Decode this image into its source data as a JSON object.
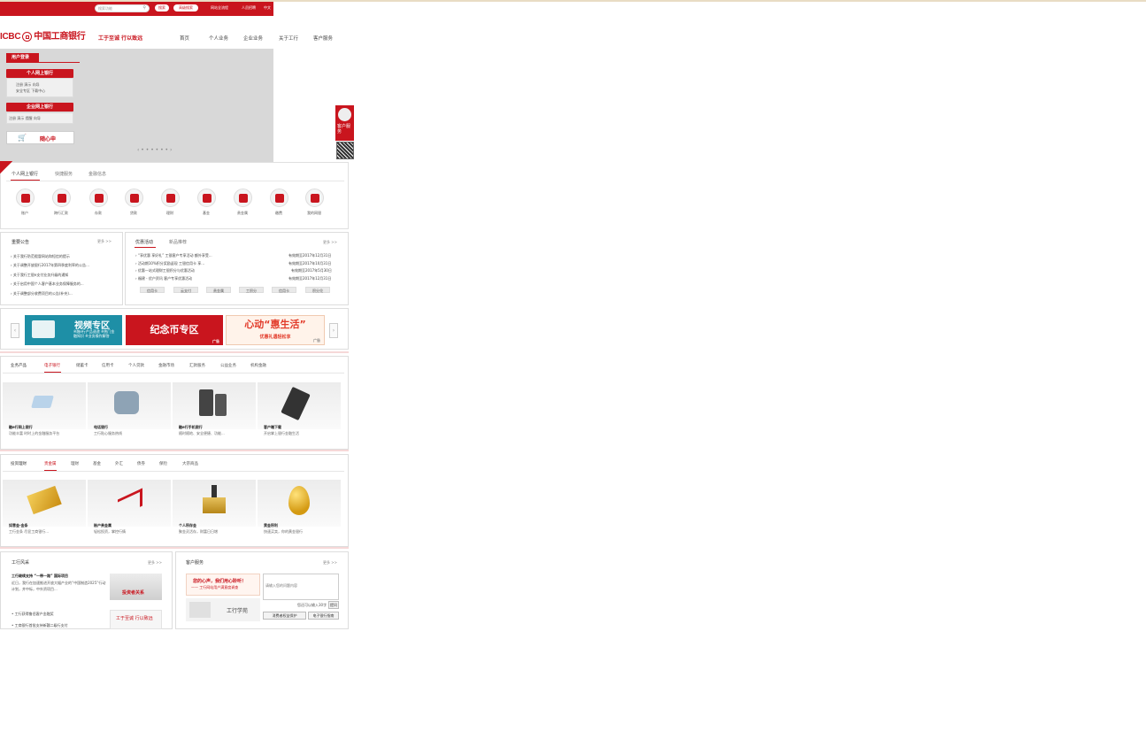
{
  "topbar": {
    "search_placeholder": "搜索功能",
    "search_btn": "搜索",
    "advanced_btn": "高级搜索",
    "links": [
      "网站全流程",
      "人员招聘",
      "中文"
    ]
  },
  "header": {
    "logo_en": "ICBC",
    "logo_cn": "中国工商银行",
    "slogan": "工于至诚  行以致远",
    "nav": [
      "首页",
      "个人业务",
      "企业业务",
      "关于工行",
      "客户服务"
    ]
  },
  "login": {
    "tab": "用户登录",
    "personal_btn": "个人网上银行",
    "personal_links": [
      "注册",
      "演示",
      "向导",
      "学",
      "安全专区",
      "下载中心"
    ],
    "corporate_btn": "企业网上银行",
    "corporate_links": [
      "注册",
      "演示",
      "提醒",
      "向导"
    ],
    "apply_label": "随心申"
  },
  "hero": {
    "dots": "‹   • • • • • •   ›"
  },
  "float": {
    "label": "客户服务"
  },
  "quick": {
    "tabs": [
      "个人网上银行",
      "快捷服务",
      "金融信息"
    ],
    "items": [
      "账户",
      "跨行汇款",
      "存款",
      "贷款",
      "理财",
      "基金",
      "贵金属",
      "缴费",
      "我的网银"
    ]
  },
  "notices": {
    "title": "重要公告",
    "more": "更多 >>",
    "items": [
      "关于我行防范假冒网站和短信的提示",
      "关于调整开放银行2017年第四季度利率的公告...",
      "关于我行工银e支付业务升级的通知",
      "关于启用中国个人客户基本业务保障服务的...",
      "关于调整部分收费项目的公告(补充)..."
    ]
  },
  "promos": {
    "tabs": [
      "优惠活动",
      "新品推荐"
    ],
    "more": "更多 >>",
    "items": [
      "“享优惠 享好礼” 工银客户专享活动 额外享受...",
      "活动期10%积分奖励返现 工银信用卡 享...",
      "优惠一站式理财工银积分与优惠活动",
      "福建 - 优户资讯 客户专享优惠活动"
    ],
    "dates": [
      "有效期至2017年12月31日",
      "有效期至2017年10月31日",
      "有效期至2017年5月30日",
      "有效期至2017年12月31日"
    ],
    "tags": [
      "信用卡",
      "云支付",
      "贵金属",
      "工积分",
      "信用卡",
      "积分兑"
    ]
  },
  "banners": {
    "video_title": "视频专区",
    "video_sub": "※融e行产品速递  ※热门金融知识  ※业务操作解答",
    "coin_title": "纪念币专区",
    "life_title": "心动“惠生活”",
    "life_sub": "优惠礼遇轻松享",
    "ad": "广告",
    "prev": "‹",
    "next": "›"
  },
  "products": {
    "tabs": [
      "业务产品",
      "电子银行",
      "储蓄卡",
      "信用卡",
      "个人贷款",
      "金融市场",
      "汇款服务",
      "公益业务",
      "机构金融"
    ],
    "cards": [
      {
        "title": "融e行网上银行",
        "desc": "功能丰富 时时上的金融服务平台"
      },
      {
        "title": "电话银行",
        "desc": "工行贴心服务热线"
      },
      {
        "title": "融e行手机银行",
        "desc": "随时随地、安全便捷、功能..."
      },
      {
        "title": "客户端下载",
        "desc": "开启掌上银行金融生活"
      }
    ]
  },
  "invest": {
    "tabs": [
      "投资理财",
      "贵金属",
      "理财",
      "基金",
      "外汇",
      "债券",
      "保险",
      "大宗商品"
    ],
    "cards": [
      {
        "title": "如意金·金条",
        "desc": "工行金条 尽显工商银行..."
      },
      {
        "title": "账户贵金属",
        "desc": "轻松投资，掌控行情"
      },
      {
        "title": "个人积存金",
        "desc": "聚金灵活存，财富日日增"
      },
      {
        "title": "黄金积利",
        "desc": "快速买卖，你的黄金银行"
      }
    ]
  },
  "news": {
    "title": "工行风采",
    "more": "更多 >>",
    "headline": "工行继续支持 “一带一路” 国际项目",
    "body": "近日，我行在加速推进开放大幅产业的“中国制造2025”行动计划，并中标，中外资项目...",
    "list": [
      "工行获得鲁佰客户金融奖",
      "工商银行首批支持新疆二级行支付"
    ],
    "img1": "投资者关系",
    "img2": "工于至诚  行以致远"
  },
  "service": {
    "title": "客户服务",
    "more": "更多 >>",
    "banner_top": "您的心声，我们用心聆听！",
    "banner_sub": "—— 工行网站用户满意度调查",
    "input_placeholder": "请输入您的问题内容",
    "counter": "您还可以输入30字",
    "submit": "提问",
    "guide": "工行学苑",
    "buttons": [
      "消费者权益保护",
      "电子银行指南"
    ]
  }
}
